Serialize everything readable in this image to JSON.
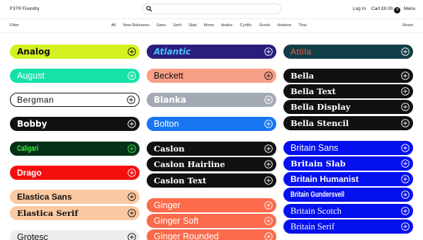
{
  "header": {
    "brand": "F37® Foundry",
    "login": "Log In",
    "cart_label": "Cart £0.00",
    "cart_count": "0",
    "menu": "Menu"
  },
  "filters": {
    "label": "Filter",
    "categories": [
      "All",
      "New Releases",
      "Sans",
      "Serif",
      "Slab",
      "Mono",
      "Arabic",
      "Cyrillic",
      "Greek",
      "Hebrew",
      "Thai"
    ],
    "reset": "Reset"
  },
  "columns": [
    [
      {
        "name": "Analog",
        "bg": "#d4f01e",
        "fg": "#111111",
        "plus": "#111111",
        "style": "heavy"
      },
      {
        "name": "August",
        "bg": "#15e2a8",
        "fg": "#ffffff",
        "plus": "#ffffff",
        "style": "sans"
      },
      {
        "name": "Bergman",
        "bg": "#ffffff",
        "fg": "#111111",
        "plus": "#111111",
        "style": "light",
        "border": "#111111"
      },
      {
        "name": "Bobby",
        "bg": "#111111",
        "fg": "#ffffff",
        "plus": "#ffffff",
        "style": "heavy"
      },
      {
        "name": "Caligari",
        "bg": "#06301a",
        "fg": "#3ef23c",
        "plus": "#3ef23c",
        "style": "condensed"
      },
      {
        "name": "Drago",
        "bg": "#f40f0f",
        "fg": "#ffffff",
        "plus": "#ffffff",
        "style": "bold"
      },
      {
        "name": "Elastica Sans",
        "bg": "#fbc9a1",
        "fg": "#111111",
        "plus": "#111111",
        "style": "bold"
      },
      {
        "name": "Elastica Serif",
        "bg": "#fbc9a1",
        "fg": "#111111",
        "plus": "#111111",
        "style": "serifbold"
      },
      {
        "name": "Grotesc",
        "bg": "#ededec",
        "fg": "#111111",
        "plus": "#111111",
        "style": "sans"
      }
    ],
    [
      {
        "name": "Atlantic",
        "bg": "#2a1e7d",
        "fg": "#49c0ff",
        "plus": "#ffffff",
        "style": "heavyitalic"
      },
      {
        "name": "Beckett",
        "bg": "#f8a087",
        "fg": "#111111",
        "plus": "#111111",
        "style": "sans"
      },
      {
        "name": "Blanka",
        "bg": "#a4aab3",
        "fg": "#ffffff",
        "plus": "#ffffff",
        "style": "heavy"
      },
      {
        "name": "Bolton",
        "bg": "#1876f2",
        "fg": "#ffffff",
        "plus": "#ffffff",
        "style": "sans"
      },
      {
        "name": "Caslon",
        "bg": "#111111",
        "fg": "#ffffff",
        "plus": "#ffffff",
        "style": "serifbold"
      },
      {
        "name": "Caslon Hairline",
        "bg": "#111111",
        "fg": "#ffffff",
        "plus": "#ffffff",
        "style": "serifbold"
      },
      {
        "name": "Caslon Text",
        "bg": "#111111",
        "fg": "#ffffff",
        "plus": "#ffffff",
        "style": "serifbold"
      },
      {
        "name": "Ginger",
        "bg": "#fb6a4a",
        "fg": "#ffffff",
        "plus": "#ffffff",
        "style": "sans"
      },
      {
        "name": "Ginger Soft",
        "bg": "#fb6a4a",
        "fg": "#ffffff",
        "plus": "#ffffff",
        "style": "sans"
      },
      {
        "name": "Ginger Rounded",
        "bg": "#fb6a4a",
        "fg": "#ffffff",
        "plus": "#ffffff",
        "style": "sans"
      }
    ],
    [
      {
        "name": "Attila",
        "bg": "#123e48",
        "fg": "#f0614b",
        "plus": "#ffffff",
        "style": "light"
      },
      {
        "name": "Bella",
        "bg": "#111111",
        "fg": "#ffffff",
        "plus": "#ffffff",
        "style": "serifbold"
      },
      {
        "name": "Bella Text",
        "bg": "#111111",
        "fg": "#ffffff",
        "plus": "#ffffff",
        "style": "serifbold"
      },
      {
        "name": "Bella Display",
        "bg": "#111111",
        "fg": "#ffffff",
        "plus": "#ffffff",
        "style": "serifbold"
      },
      {
        "name": "Bella Stencil",
        "bg": "#111111",
        "fg": "#ffffff",
        "plus": "#ffffff",
        "style": "serifbold"
      },
      {
        "name": "Britain Sans",
        "bg": "#0510ee",
        "fg": "#ffffff",
        "plus": "#ffffff",
        "style": "sans"
      },
      {
        "name": "Britain Slab",
        "bg": "#0510ee",
        "fg": "#ffffff",
        "plus": "#ffffff",
        "style": "serifbold"
      },
      {
        "name": "Britain Humanist",
        "bg": "#0510ee",
        "fg": "#ffffff",
        "plus": "#ffffff",
        "style": "bold"
      },
      {
        "name": "Britain Gundersvell",
        "bg": "#0510ee",
        "fg": "#ffffff",
        "plus": "#ffffff",
        "style": "condensed"
      },
      {
        "name": "Britain Scotch",
        "bg": "#0510ee",
        "fg": "#ffffff",
        "plus": "#ffffff",
        "style": "serif"
      },
      {
        "name": "Britain Serif",
        "bg": "#0510ee",
        "fg": "#ffffff",
        "plus": "#ffffff",
        "style": "serif"
      }
    ]
  ]
}
